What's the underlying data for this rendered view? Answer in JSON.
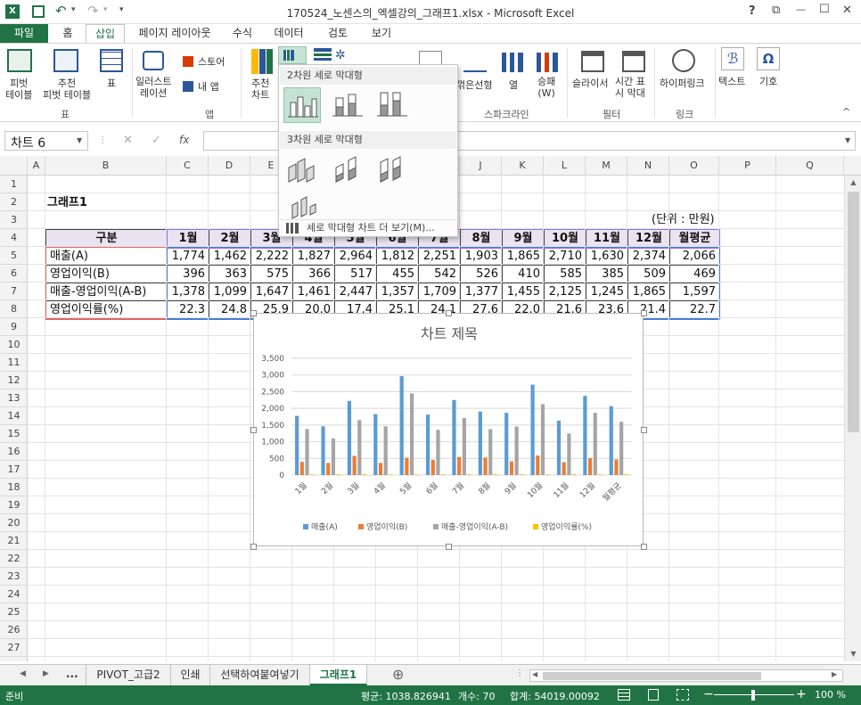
{
  "window": {
    "title": "170524_노센스의_엑셀강의_그래프1.xlsx - Microsoft Excel",
    "help": "?",
    "restore": "⧉",
    "min": "—",
    "max": "☐",
    "close": "✕"
  },
  "qat": {
    "undo": "↶",
    "redo": "↷",
    "more": "▾"
  },
  "tabs": [
    {
      "label": "파일"
    },
    {
      "label": "홈"
    },
    {
      "label": "삽입"
    },
    {
      "label": "페이지 레이아웃"
    },
    {
      "label": "수식"
    },
    {
      "label": "데이터"
    },
    {
      "label": "검토"
    },
    {
      "label": "보기"
    }
  ],
  "ribbon": {
    "pivot": "피벗\n테이블",
    "recommended_pivot": "추천\n피벗 테이블",
    "table": "표",
    "illustration": "일러스트\n레이션",
    "store": "스토어",
    "myapps": "내 앱",
    "recommended_chart": "추천\n차트",
    "spark_line": "꺾은선형",
    "spark_col": "열",
    "spark_winloss": "승패\n(W)",
    "slicer": "슬라이서",
    "timeline": "시간 표\n시 막대",
    "hyperlink": "하이퍼링크",
    "text": "텍스트",
    "symbol": "기호",
    "groups": {
      "table": "표",
      "apps": "앱",
      "sparkline": "스파크라인",
      "filter": "필터",
      "link": "링크"
    }
  },
  "dropdown": {
    "header2d": "2차원 세로 막대형",
    "header3d": "3차원 세로 막대형",
    "more": "세로 막대형 차트 더 보기(M)..."
  },
  "formula_bar": {
    "name_box": "차트 6",
    "fx": "fx",
    "cancel": "✕",
    "confirm": "✓",
    "value": ""
  },
  "columns": [
    "A",
    "B",
    "C",
    "D",
    "E",
    "F",
    "G",
    "H",
    "I",
    "J",
    "K",
    "L",
    "M",
    "N",
    "O",
    "P",
    "Q"
  ],
  "rows": [
    "1",
    "2",
    "3",
    "4",
    "5",
    "6",
    "7",
    "8",
    "9",
    "10",
    "11",
    "12",
    "13",
    "14",
    "15",
    "16",
    "17",
    "18",
    "19",
    "20",
    "21",
    "22",
    "23",
    "24",
    "25",
    "26",
    "27"
  ],
  "sheet": {
    "title": "그래프1",
    "unit": "(단위 : 만원)",
    "header": [
      "구분",
      "1월",
      "2월",
      "3월",
      "4월",
      "5월",
      "6월",
      "7월",
      "8월",
      "9월",
      "10월",
      "11월",
      "12월",
      "월평균"
    ],
    "rows": [
      [
        "매출(A)",
        "1,774",
        "1,462",
        "2,222",
        "1,827",
        "2,964",
        "1,812",
        "2,251",
        "1,903",
        "1,865",
        "2,710",
        "1,630",
        "2,374",
        "2,066"
      ],
      [
        "영업이익(B)",
        "396",
        "363",
        "575",
        "366",
        "517",
        "455",
        "542",
        "526",
        "410",
        "585",
        "385",
        "509",
        "469"
      ],
      [
        "매출-영업이익(A-B)",
        "1,378",
        "1,099",
        "1,647",
        "1,461",
        "2,447",
        "1,357",
        "1,709",
        "1,377",
        "1,455",
        "2,125",
        "1,245",
        "1,865",
        "1,597"
      ],
      [
        "영업이익률(%)",
        "22.3",
        "24.8",
        "25.9",
        "20.0",
        "17.4",
        "25.1",
        "24.1",
        "27.6",
        "22.0",
        "21.6",
        "23.6",
        "21.4",
        "22.7"
      ]
    ]
  },
  "chart_data": {
    "type": "bar",
    "title": "차트 제목",
    "categories": [
      "1월",
      "2월",
      "3월",
      "4월",
      "5월",
      "6월",
      "7월",
      "8월",
      "9월",
      "10월",
      "11월",
      "12월",
      "월평균"
    ],
    "series": [
      {
        "name": "매출(A)",
        "color": "#5b9bd5",
        "values": [
          1774,
          1462,
          2222,
          1827,
          2964,
          1812,
          2251,
          1903,
          1865,
          2710,
          1630,
          2374,
          2066
        ]
      },
      {
        "name": "영업이익(B)",
        "color": "#ed7d31",
        "values": [
          396,
          363,
          575,
          366,
          517,
          455,
          542,
          526,
          410,
          585,
          385,
          509,
          469
        ]
      },
      {
        "name": "매출-영업이익(A-B)",
        "color": "#a5a5a5",
        "values": [
          1378,
          1099,
          1647,
          1461,
          2447,
          1357,
          1709,
          1377,
          1455,
          2125,
          1245,
          1865,
          1597
        ]
      },
      {
        "name": "영업이익률(%)",
        "color": "#ffc000",
        "values": [
          22.3,
          24.8,
          25.9,
          20.0,
          17.4,
          25.1,
          24.1,
          27.6,
          22.0,
          21.6,
          23.6,
          21.4,
          22.7
        ]
      }
    ],
    "ylim": [
      0,
      3500
    ],
    "yticks": [
      "0",
      "500",
      "1,000",
      "1,500",
      "2,000",
      "2,500",
      "3,000",
      "3,500"
    ],
    "grid": true,
    "legend": "bottom"
  },
  "sheet_tabs": [
    "PIVOT_고급2",
    "인쇄",
    "선택하여붙여넣기",
    "그래프1"
  ],
  "sheet_nav": {
    "prev": "◀",
    "next": "▶",
    "more": "...",
    "add": "⊕"
  },
  "status": {
    "ready": "준비",
    "average": "평균: 1038.826941",
    "count": "개수: 70",
    "sum": "합계: 54019.00092",
    "zoom": "100 %",
    "zoom_minus": "−",
    "zoom_plus": "+"
  },
  "colors": {
    "excel_green": "#217346",
    "header_fill": "#e8e4f1"
  }
}
